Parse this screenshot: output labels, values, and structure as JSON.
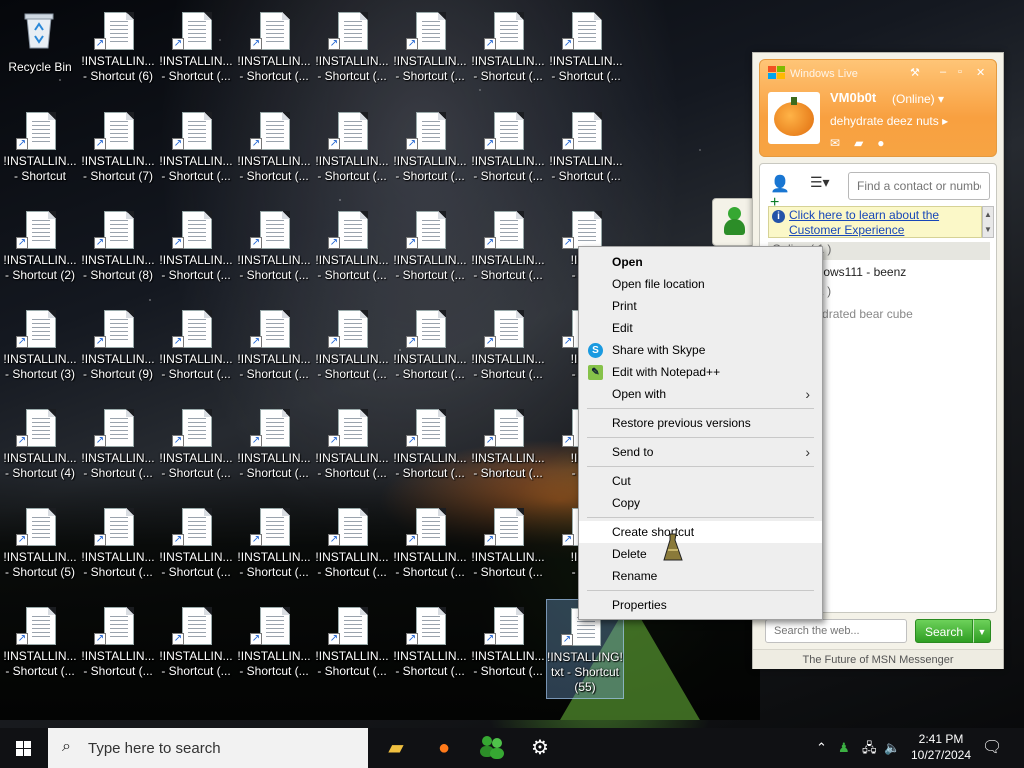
{
  "desktop": {
    "recycle_bin": "Recycle Bin",
    "icons": [
      [
        "!INSTALLIN...",
        "- Shortcut (6)"
      ],
      [
        "!INSTALLIN...",
        "- Shortcut (..."
      ],
      [
        "!INSTALLIN...",
        "- Shortcut (..."
      ],
      [
        "!INSTALLIN...",
        "- Shortcut (..."
      ],
      [
        "!INSTALLIN...",
        "- Shortcut (..."
      ],
      [
        "!INSTALLIN...",
        "- Shortcut (..."
      ],
      [
        "!INSTALLIN...",
        "- Shortcut (..."
      ],
      [
        "!INSTALLIN...",
        "- Shortcut"
      ],
      [
        "!INSTALLIN...",
        "- Shortcut (7)"
      ],
      [
        "!INSTALLIN...",
        "- Shortcut (..."
      ],
      [
        "!INSTALLIN...",
        "- Shortcut (..."
      ],
      [
        "!INSTALLIN...",
        "- Shortcut (..."
      ],
      [
        "!INSTALLIN...",
        "- Shortcut (..."
      ],
      [
        "!INSTALLIN...",
        "- Shortcut (..."
      ],
      [
        "!INSTALLIN...",
        "- Shortcut (..."
      ],
      [
        "!INSTALLIN...",
        "- Shortcut (2)"
      ],
      [
        "!INSTALLIN...",
        "- Shortcut (8)"
      ],
      [
        "!INSTALLIN...",
        "- Shortcut (..."
      ],
      [
        "!INSTALLIN...",
        "- Shortcut (..."
      ],
      [
        "!INSTALLIN...",
        "- Shortcut (..."
      ],
      [
        "!INSTALLIN...",
        "- Shortcut (..."
      ],
      [
        "!INSTALLIN...",
        "- Shortcut (..."
      ],
      [
        "!INST",
        "- Sho"
      ],
      [
        "!INSTALLIN...",
        "- Shortcut (3)"
      ],
      [
        "!INSTALLIN...",
        "- Shortcut (9)"
      ],
      [
        "!INSTALLIN...",
        "- Shortcut (..."
      ],
      [
        "!INSTALLIN...",
        "- Shortcut (..."
      ],
      [
        "!INSTALLIN...",
        "- Shortcut (..."
      ],
      [
        "!INSTALLIN...",
        "- Shortcut (..."
      ],
      [
        "!INSTALLIN...",
        "- Shortcut (..."
      ],
      [
        "!INST",
        "- Sho"
      ],
      [
        "!INSTALLIN...",
        "- Shortcut (4)"
      ],
      [
        "!INSTALLIN...",
        "- Shortcut (..."
      ],
      [
        "!INSTALLIN...",
        "- Shortcut (..."
      ],
      [
        "!INSTALLIN...",
        "- Shortcut (..."
      ],
      [
        "!INSTALLIN...",
        "- Shortcut (..."
      ],
      [
        "!INSTALLIN...",
        "- Shortcut (..."
      ],
      [
        "!INSTALLIN...",
        "- Shortcut (..."
      ],
      [
        "!INST",
        "- Sho"
      ],
      [
        "!INSTALLIN...",
        "- Shortcut (5)"
      ],
      [
        "!INSTALLIN...",
        "- Shortcut (..."
      ],
      [
        "!INSTALLIN...",
        "- Shortcut (..."
      ],
      [
        "!INSTALLIN...",
        "- Shortcut (..."
      ],
      [
        "!INSTALLIN...",
        "- Shortcut (..."
      ],
      [
        "!INSTALLIN...",
        "- Shortcut (..."
      ],
      [
        "!INSTALLIN...",
        "- Shortcut (..."
      ],
      [
        "!INST",
        "- Sho"
      ],
      [
        "!INSTALLIN...",
        "- Shortcut (..."
      ],
      [
        "!INSTALLIN...",
        "- Shortcut (..."
      ],
      [
        "!INSTALLIN...",
        "- Shortcut (..."
      ],
      [
        "!INSTALLIN...",
        "- Shortcut (..."
      ],
      [
        "!INSTALLIN...",
        "- Shortcut (..."
      ],
      [
        "!INSTALLIN...",
        "- Shortcut (..."
      ],
      [
        "!INSTALLIN...",
        "- Shortcut (..."
      ]
    ],
    "selected_icon": [
      "!INSTALLING!.",
      "txt - Shortcut",
      "(55)"
    ]
  },
  "context_menu": {
    "open": "Open",
    "open_location": "Open file location",
    "print": "Print",
    "edit": "Edit",
    "share_skype": "Share with Skype",
    "edit_notepad": "Edit with Notepad++",
    "open_with": "Open with",
    "restore": "Restore previous versions",
    "send_to": "Send to",
    "cut": "Cut",
    "copy": "Copy",
    "create_shortcut": "Create shortcut",
    "delete": "Delete",
    "rename": "Rename",
    "properties": "Properties"
  },
  "messenger": {
    "title": "Windows Live",
    "username": "VM0b0t",
    "status": "(Online)",
    "personal_message": "dehydrate deez nuts",
    "find_placeholder": "Find a contact or number",
    "info_link": "Click here to learn about the Customer Experience",
    "online_group": "Online ( 1 )",
    "online_contact": "Windows111 - beenz",
    "offline_group": "Offline ( 2 )",
    "offline_contact": "dehydrated bear cube",
    "web_search_placeholder": "Search the web...",
    "search_button": "Search",
    "footer": "The Future of MSN Messenger",
    "colors": {
      "header": "#f8a040",
      "search": "#2f9e23"
    }
  },
  "taskbar": {
    "search_placeholder": "Type here to search",
    "time": "2:41 PM",
    "date": "10/27/2024"
  }
}
